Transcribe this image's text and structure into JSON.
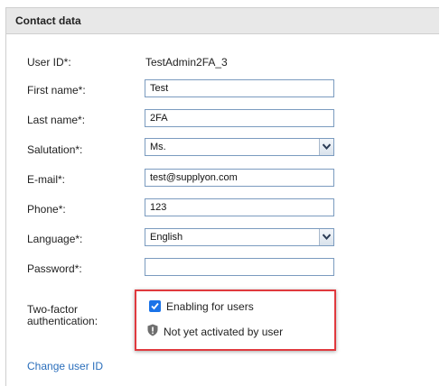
{
  "section": {
    "title": "Contact data"
  },
  "form": {
    "user_id": {
      "label": "User ID*:",
      "value": "TestAdmin2FA_3"
    },
    "first_name": {
      "label": "First name*:",
      "value": "Test"
    },
    "last_name": {
      "label": "Last name*:",
      "value": "2FA"
    },
    "salutation": {
      "label": "Salutation*:",
      "value": "Ms."
    },
    "email": {
      "label": "E-mail*:",
      "value": "test@supplyon.com"
    },
    "phone": {
      "label": "Phone*:",
      "value": "123"
    },
    "language": {
      "label": "Language*:",
      "value": "English"
    },
    "password": {
      "label": "Password*:",
      "value": ""
    },
    "two_factor": {
      "label_line1": "Two-factor",
      "label_line2": "authentication:",
      "checkbox_label": "Enabling for users",
      "checked": true,
      "status_text": "Not yet activated by user",
      "status_icon": "shield-icon"
    }
  },
  "links": {
    "change_user_id": "Change user ID"
  },
  "colors": {
    "header_bg": "#e8e8e8",
    "input_border": "#7b9bbf",
    "checkbox_accent": "#1a73e8",
    "highlight": "#e0393e",
    "link": "#2a6ebb"
  }
}
